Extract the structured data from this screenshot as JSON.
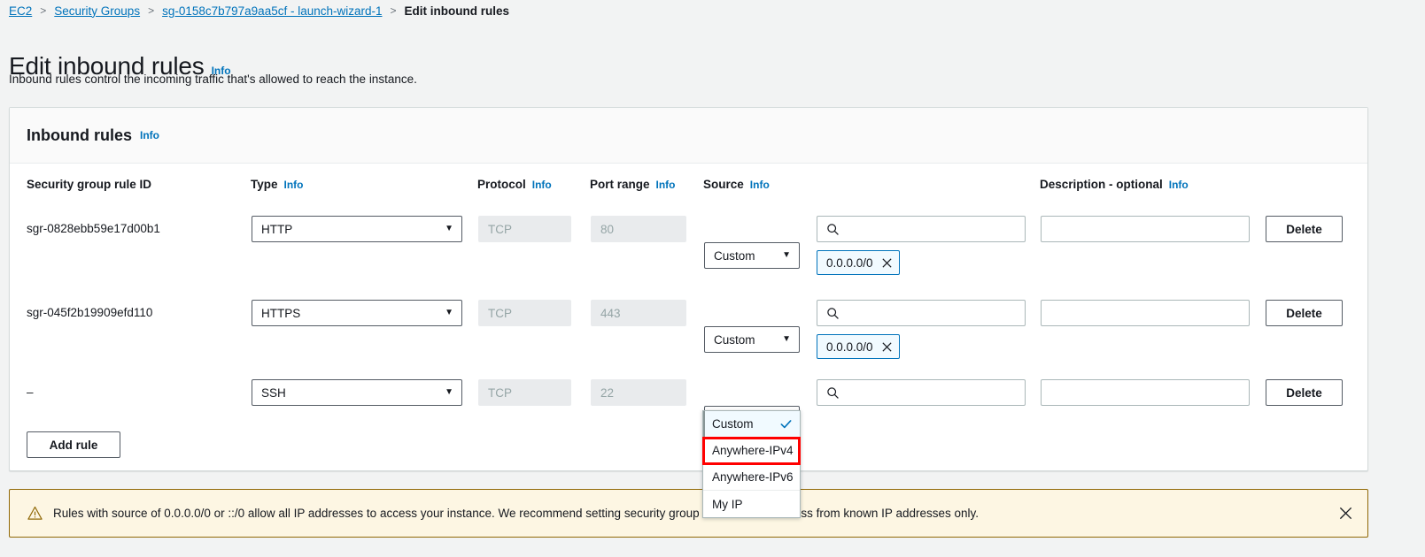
{
  "breadcrumb": {
    "items": [
      {
        "label": "EC2",
        "type": "link"
      },
      {
        "label": "Security Groups",
        "type": "link"
      },
      {
        "label": "sg-0158c7b797a9aa5cf - launch-wizard-1",
        "type": "link"
      },
      {
        "label": "Edit inbound rules",
        "type": "current"
      }
    ],
    "separator": ">"
  },
  "page": {
    "title": "Edit inbound rules",
    "info_label": "Info",
    "description": "Inbound rules control the incoming traffic that's allowed to reach the instance."
  },
  "card": {
    "title": "Inbound rules",
    "info_label": "Info"
  },
  "table": {
    "columns": [
      {
        "label": "Security group rule ID",
        "info": ""
      },
      {
        "label": "Type",
        "info": "Info"
      },
      {
        "label": "Protocol",
        "info": "Info"
      },
      {
        "label": "Port range",
        "info": "Info"
      },
      {
        "label": "Source",
        "info": "Info"
      },
      {
        "label": "Description - optional",
        "info": "Info"
      }
    ],
    "rows": [
      {
        "rule_id": "sgr-0828ebb59e17d00b1",
        "type": "HTTP",
        "protocol": "TCP",
        "port_range": "80",
        "source_type": "Custom",
        "source_search_value": "",
        "source_tokens": [
          "0.0.0.0/0"
        ],
        "description": "",
        "delete_label": "Delete"
      },
      {
        "rule_id": "sgr-045f2b19909efd110",
        "type": "HTTPS",
        "protocol": "TCP",
        "port_range": "443",
        "source_type": "Custom",
        "source_search_value": "",
        "source_tokens": [
          "0.0.0.0/0"
        ],
        "description": "",
        "delete_label": "Delete"
      },
      {
        "rule_id": "–",
        "type": "SSH",
        "protocol": "TCP",
        "port_range": "22",
        "source_type": "Custom",
        "source_search_value": "",
        "source_tokens": [],
        "description": "",
        "delete_label": "Delete"
      }
    ],
    "add_rule_label": "Add rule"
  },
  "source_dropdown": {
    "open": true,
    "options": [
      {
        "label": "Custom",
        "selected": true,
        "highlighted": false
      },
      {
        "label": "Anywhere-IPv4",
        "selected": false,
        "highlighted": true
      },
      {
        "label": "Anywhere-IPv6",
        "selected": false,
        "highlighted": false
      },
      {
        "label": "My IP",
        "selected": false,
        "highlighted": false
      }
    ]
  },
  "alert": {
    "text": "Rules with source of 0.0.0.0/0 or ::/0 allow all IP addresses to access your instance. We recommend setting security group rules to allow access from known IP addresses only.",
    "icon": "warning-triangle-icon",
    "dismiss_icon": "close-icon"
  },
  "colors": {
    "link": "#0073bb",
    "highlight_outline": "#ff0000",
    "alert_bg": "#fdf6e3",
    "alert_border": "#906806",
    "token_bg": "#f1faff",
    "token_border": "#0073bb",
    "disabled_bg": "#e9ebed",
    "page_bg": "#f2f3f3"
  }
}
